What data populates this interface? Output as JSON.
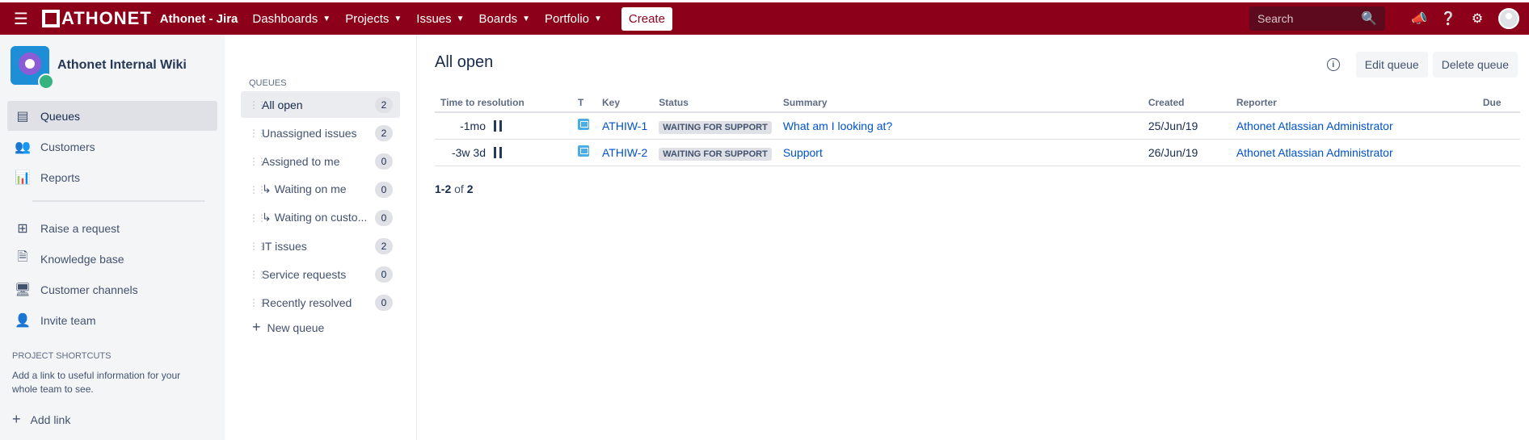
{
  "topnav": {
    "logo": "ATHONET",
    "app_title": "Athonet - Jira",
    "items": [
      {
        "label": "Dashboards"
      },
      {
        "label": "Projects"
      },
      {
        "label": "Issues"
      },
      {
        "label": "Boards"
      },
      {
        "label": "Portfolio"
      }
    ],
    "create_label": "Create",
    "search_placeholder": "Search",
    "icons": [
      "menu-icon",
      "search-icon",
      "announcement-icon",
      "help-icon",
      "settings-icon",
      "user-avatar"
    ],
    "accent_color": "#8c0019"
  },
  "sidebar": {
    "project_name": "Athonet Internal Wiki",
    "nav": [
      {
        "label": "Queues",
        "icon": "queues-icon",
        "active": true
      },
      {
        "label": "Customers",
        "icon": "customers-icon"
      },
      {
        "label": "Reports",
        "icon": "reports-icon"
      }
    ],
    "nav2": [
      {
        "label": "Raise a request",
        "icon": "raise-request-icon"
      },
      {
        "label": "Knowledge base",
        "icon": "knowledge-base-icon"
      },
      {
        "label": "Customer channels",
        "icon": "customer-channels-icon"
      },
      {
        "label": "Invite team",
        "icon": "invite-team-icon"
      }
    ],
    "shortcuts_heading": "PROJECT SHORTCUTS",
    "shortcuts_text": "Add a link to useful information for your whole team to see.",
    "add_link": "Add link"
  },
  "queues": {
    "heading": "QUEUES",
    "items": [
      {
        "label": "All open",
        "count": "2",
        "active": true
      },
      {
        "label": "Unassigned issues",
        "count": "2"
      },
      {
        "label": "Assigned to me",
        "count": "0"
      },
      {
        "label": "↳ Waiting on me",
        "count": "0"
      },
      {
        "label": "↳ Waiting on custo...",
        "count": "0"
      },
      {
        "label": "IT issues",
        "count": "2"
      },
      {
        "label": "Service requests",
        "count": "0"
      },
      {
        "label": "Recently resolved",
        "count": "0"
      }
    ],
    "new_queue": "New queue"
  },
  "main": {
    "title": "All open",
    "edit_queue": "Edit queue",
    "delete_queue": "Delete queue",
    "columns": [
      "Time to resolution",
      "T",
      "Key",
      "Status",
      "Summary",
      "Created",
      "Reporter",
      "Due"
    ],
    "rows": [
      {
        "ttr": "-1mo",
        "key": "ATHIW-1",
        "status": "WAITING FOR SUPPORT",
        "summary": "What am I looking at?",
        "created": "25/Jun/19",
        "reporter": "Athonet Atlassian Administrator",
        "due": ""
      },
      {
        "ttr": "-3w 3d",
        "key": "ATHIW-2",
        "status": "WAITING FOR SUPPORT",
        "summary": "Support",
        "created": "26/Jun/19",
        "reporter": "Athonet Atlassian Administrator",
        "due": ""
      }
    ],
    "pager": {
      "range": "1-2",
      "of": "of",
      "total": "2"
    }
  }
}
